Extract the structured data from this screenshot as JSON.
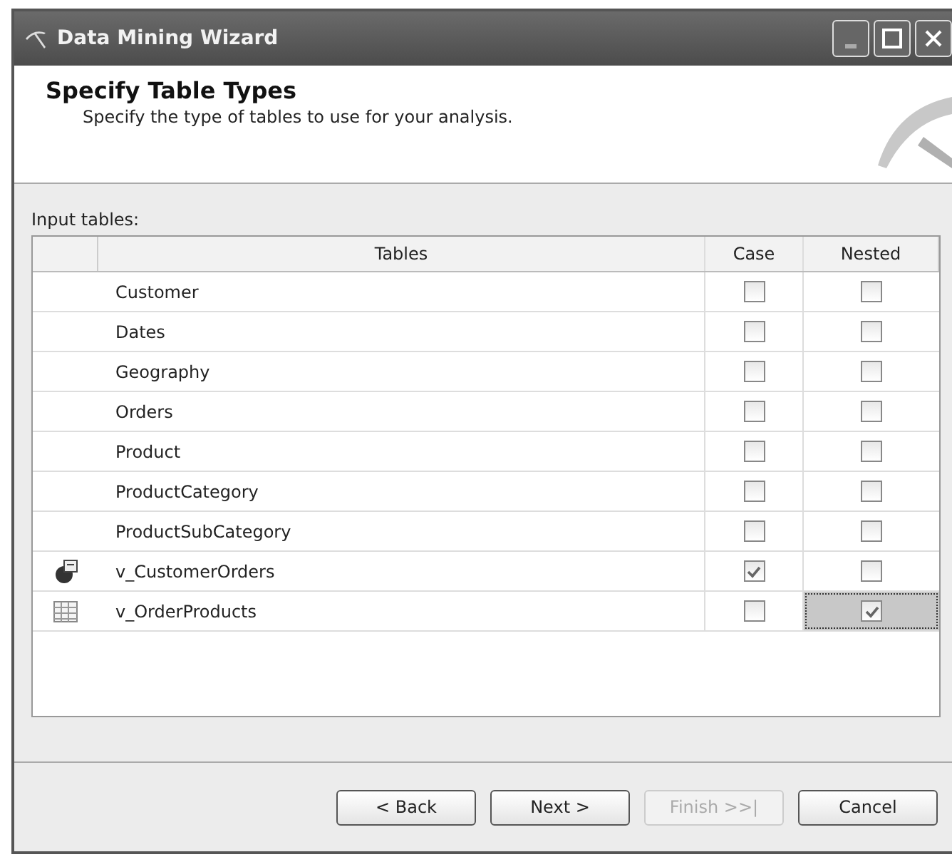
{
  "window": {
    "title": "Data Mining Wizard"
  },
  "header": {
    "title": "Specify Table Types",
    "subtitle": "Specify the type of tables to use for your analysis."
  },
  "input_tables": {
    "label": "Input tables:",
    "columns": [
      "Tables",
      "Case",
      "Nested"
    ],
    "rows": [
      {
        "name": "Customer",
        "case": false,
        "nested": false,
        "selected": false
      },
      {
        "name": "Dates",
        "case": false,
        "nested": false,
        "selected": false
      },
      {
        "name": "Geography",
        "case": false,
        "nested": false,
        "selected": false
      },
      {
        "name": "Orders",
        "case": false,
        "nested": false,
        "selected": false
      },
      {
        "name": "Product",
        "case": false,
        "nested": false,
        "selected": false
      },
      {
        "name": "ProductCategory",
        "case": false,
        "nested": false,
        "selected": false
      },
      {
        "name": "ProductSubCategory",
        "case": false,
        "nested": false,
        "selected": false
      },
      {
        "name": "v_CustomerOrders",
        "kind": "case",
        "case": true,
        "nested": false,
        "selected": false
      },
      {
        "name": "v_OrderProducts",
        "kind": "nested",
        "case": false,
        "nested": true,
        "selected": true
      }
    ]
  },
  "buttons": [
    {
      "label": "< Back",
      "disabled": false
    },
    {
      "label": "Next >",
      "disabled": false
    },
    {
      "label": "Finish >>|",
      "disabled": true
    },
    {
      "label": "Cancel",
      "disabled": false
    }
  ]
}
